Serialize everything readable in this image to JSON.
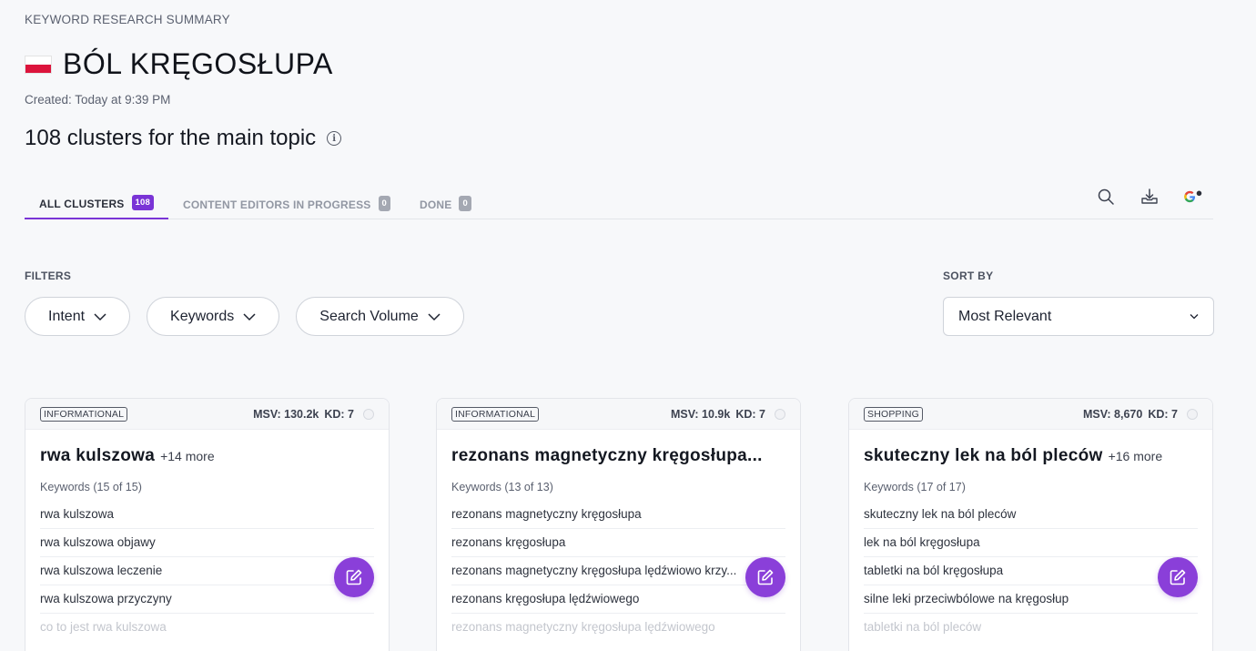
{
  "header": {
    "eyebrow": "KEYWORD RESEARCH SUMMARY",
    "title": "BÓL KRĘGOSŁUPA",
    "created": "Created: Today at 9:39 PM",
    "clusters_text": "108 clusters for the main topic"
  },
  "tabs": [
    {
      "label": "ALL CLUSTERS",
      "count": "108",
      "active": true
    },
    {
      "label": "CONTENT EDITORS IN PROGRESS",
      "count": "0",
      "active": false
    },
    {
      "label": "DONE",
      "count": "0",
      "active": false
    }
  ],
  "filters": {
    "label": "FILTERS",
    "items": [
      "Intent",
      "Keywords",
      "Search Volume"
    ]
  },
  "sort": {
    "label": "SORT BY",
    "value": "Most Relevant"
  },
  "cards": [
    {
      "intent": "INFORMATIONAL",
      "msv": "MSV: 130.2k",
      "kd": "KD: 7",
      "title": "rwa kulszowa",
      "more": "+14 more",
      "kw_count": "Keywords (15 of 15)",
      "keywords": [
        "rwa kulszowa",
        "rwa kulszowa objawy",
        "rwa kulszowa leczenie",
        "rwa kulszowa przyczyny",
        "co to jest rwa kulszowa"
      ]
    },
    {
      "intent": "INFORMATIONAL",
      "msv": "MSV: 10.9k",
      "kd": "KD: 7",
      "title": "rezonans magnetyczny kręgosłupa...",
      "more": "",
      "kw_count": "Keywords (13 of 13)",
      "keywords": [
        "rezonans magnetyczny kręgosłupa",
        "rezonans kręgosłupa",
        "rezonans magnetyczny kręgosłupa lędźwiowo krzy...",
        "rezonans kręgosłupa lędźwiowego",
        "rezonans magnetyczny kręgosłupa lędźwiowego"
      ]
    },
    {
      "intent": "SHOPPING",
      "msv": "MSV: 8,670",
      "kd": "KD: 7",
      "title": "skuteczny lek na ból pleców",
      "more": "+16 more",
      "kw_count": "Keywords (17 of 17)",
      "keywords": [
        "skuteczny lek na ból pleców",
        "lek na ból kręgosłupa",
        "tabletki na ból kręgosłupa",
        "silne leki przeciwbólowe na kręgosłup",
        "tabletki na ból pleców"
      ]
    }
  ],
  "colors": {
    "accent": "#7a34d6",
    "edit_button": "#8a3fd9",
    "flag_red": "#dc143c"
  },
  "icons": {
    "search": "search-icon",
    "download": "download-icon",
    "google": "google-icon",
    "info": "info-icon",
    "edit": "edit-icon"
  }
}
